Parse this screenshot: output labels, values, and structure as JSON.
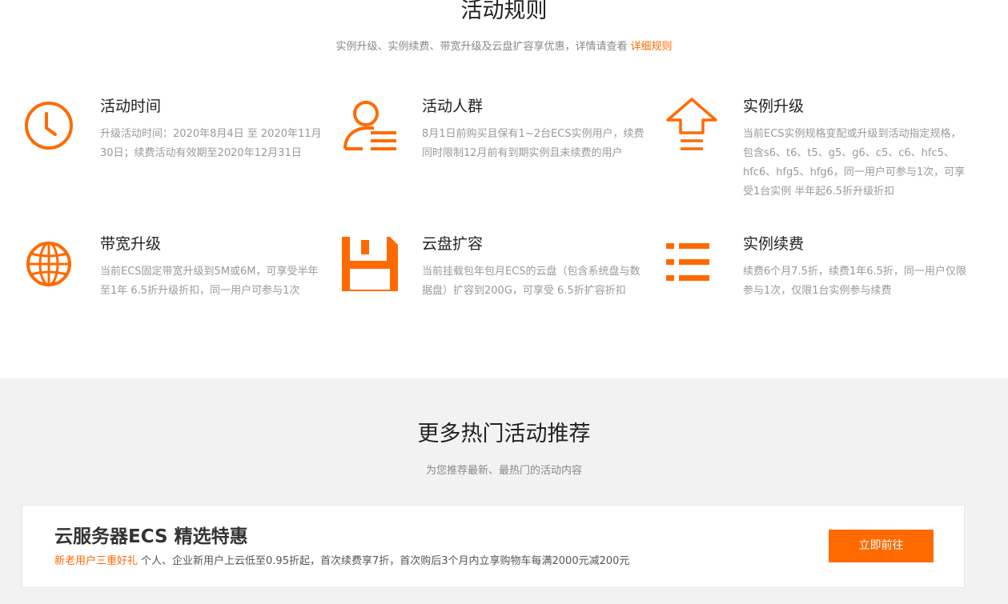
{
  "rules": {
    "title": "活动规则",
    "subtitle": "实例升级、实例续费、带宽升级及云盘扩容享优惠，详情请查看",
    "link": "详细规则",
    "items": [
      {
        "icon": "clock-icon",
        "title": "活动时间",
        "desc": "升级活动时间：2020年8月4日 至 2020年11月30日；续费活动有效期至2020年12月31日"
      },
      {
        "icon": "user-group-icon",
        "title": "活动人群",
        "desc": "8月1日前购买且保有1~2台ECS实例用户，续费同时限制12月前有到期实例且未续费的用户"
      },
      {
        "icon": "upgrade-arrow-icon",
        "title": "实例升级",
        "desc": "当前ECS实例规格变配或升级到活动指定规格，包含s6、t6、t5、g5、g6、c5、c6、hfc5、hfc6、hfg5、hfg6，同一用户可参与1次，可享受1台实例 半年起6.5折升级折扣"
      },
      {
        "icon": "globe-icon",
        "title": "带宽升级",
        "desc": "当前ECS固定带宽升级到5M或6M，可享受半年至1年 6.5折升级折扣，同一用户可参与1次"
      },
      {
        "icon": "disk-save-icon",
        "title": "云盘扩容",
        "desc": "当前挂载包年包月ECS的云盘（包含系统盘与数据盘）扩容到200G，可享受 6.5折扩容折扣"
      },
      {
        "icon": "list-icon",
        "title": "实例续费",
        "desc": "续费6个月7.5折，续费1年6.5折，同一用户仅限参与1次，仅限1台实例参与续费"
      }
    ]
  },
  "more": {
    "title": "更多热门活动推荐",
    "subtitle": "为您推荐最新、最热门的活动内容",
    "card": {
      "title": "云服务器ECS 精选特惠",
      "tag": "新老用户三重好礼",
      "desc": "个人、企业新用户上云低至0.95折起，首次续费享7折，首次购后3个月内立享购物车每满2000元减200元",
      "button": "立即前往"
    }
  },
  "colors": {
    "accent": "#ff6a00",
    "section_bg": "#f2f2f2"
  }
}
